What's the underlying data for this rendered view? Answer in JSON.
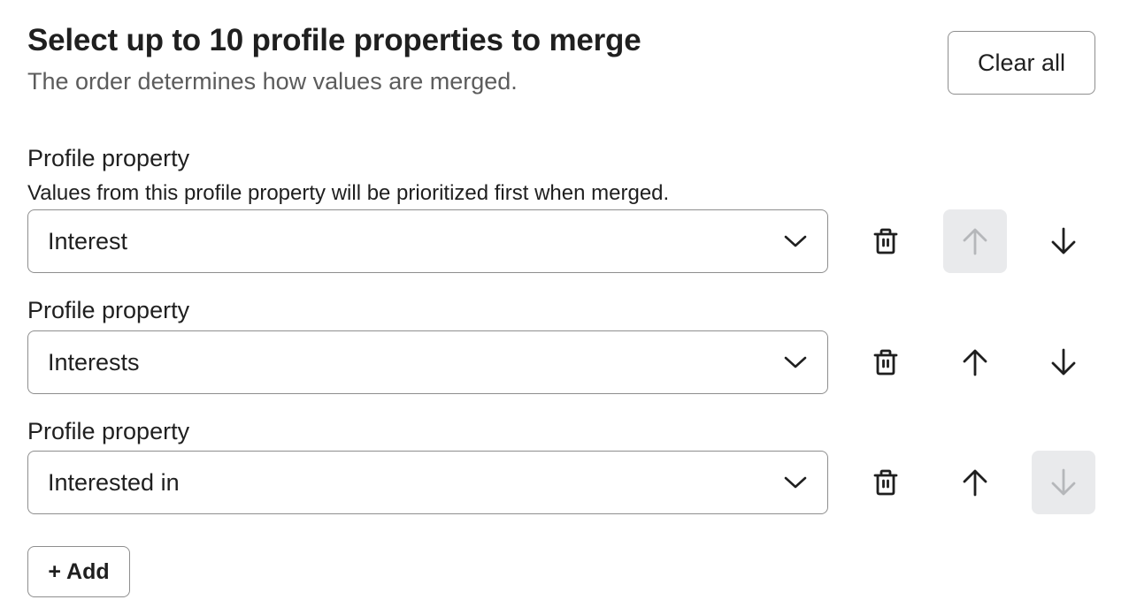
{
  "header": {
    "title": "Select up to 10 profile properties to merge",
    "subtitle": "The order determines how values are merged.",
    "clear_all_label": "Clear all"
  },
  "rows": [
    {
      "label": "Profile property",
      "help": "Values from this profile property will be prioritized first when merged.",
      "value": "Interest",
      "delete_icon": "trash-icon",
      "move_up_disabled": true,
      "move_down_disabled": false
    },
    {
      "label": "Profile property",
      "help": null,
      "value": "Interests",
      "delete_icon": "trash-icon",
      "move_up_disabled": false,
      "move_down_disabled": false
    },
    {
      "label": "Profile property",
      "help": null,
      "value": "Interested in",
      "delete_icon": "trash-icon",
      "move_up_disabled": false,
      "move_down_disabled": true
    }
  ],
  "add_label": "+ Add",
  "colors": {
    "text": "#1f1f1f",
    "muted_text": "#5c5c5c",
    "border": "#8e8e8e",
    "disabled_bg": "#e9eaec",
    "disabled_icon": "#b5b7ba"
  }
}
